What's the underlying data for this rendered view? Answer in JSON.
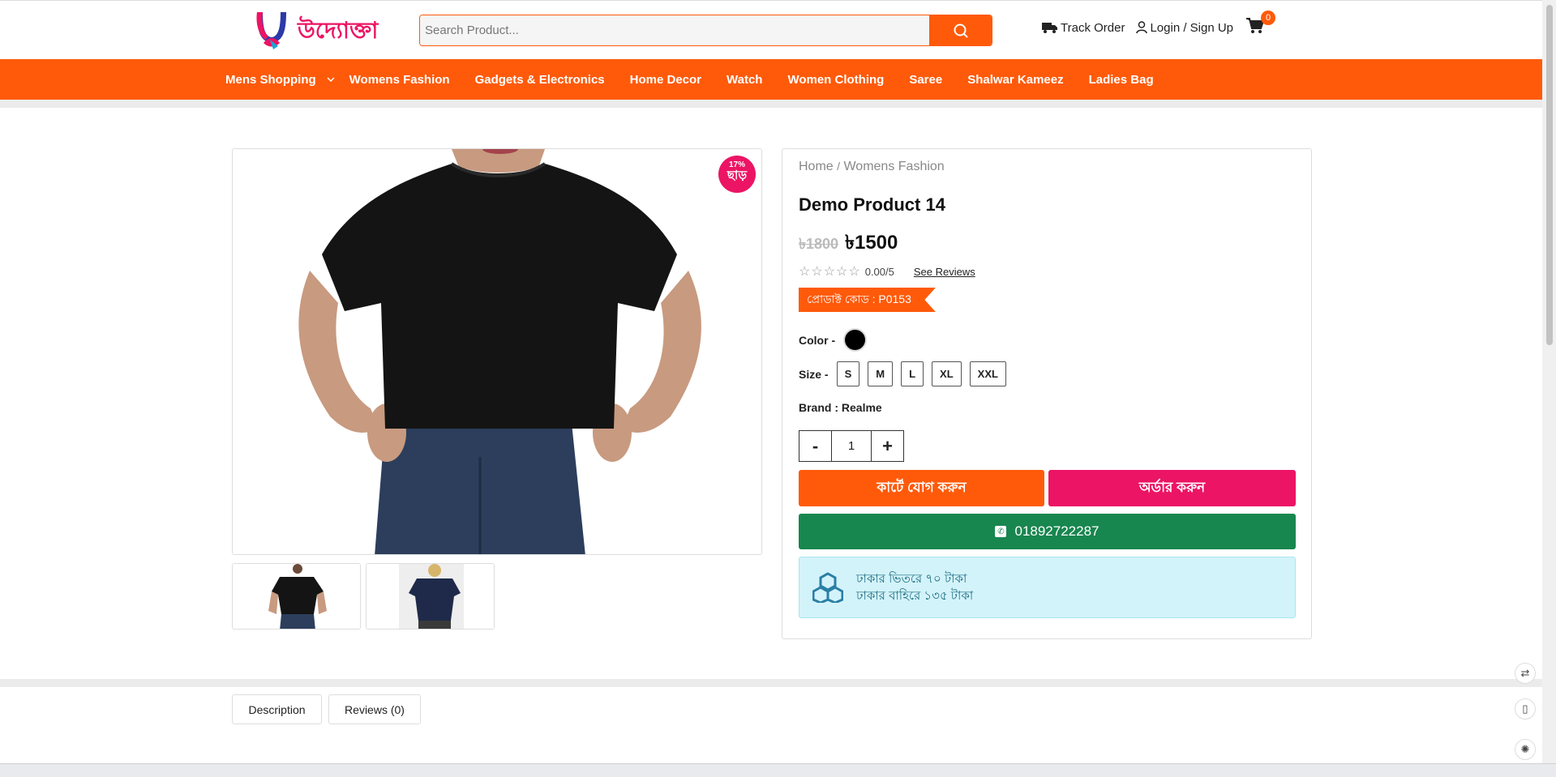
{
  "header": {
    "logo_alt": "উদ্যোক্তা",
    "search_placeholder": "Search Product...",
    "track_order": "Track Order",
    "login": "Login / Sign Up",
    "cart_count": "0"
  },
  "nav": {
    "items": [
      {
        "label": "Mens Shopping",
        "has_dropdown": true
      },
      {
        "label": "Womens Fashion"
      },
      {
        "label": "Gadgets & Electronics"
      },
      {
        "label": "Home Decor"
      },
      {
        "label": "Watch"
      },
      {
        "label": "Women Clothing"
      },
      {
        "label": "Saree"
      },
      {
        "label": "Shalwar Kameez"
      },
      {
        "label": "Ladies Bag"
      }
    ]
  },
  "product": {
    "discount_pct": "17%",
    "discount_label": "ছাড়",
    "breadcrumb_home": "Home",
    "breadcrumb_sep": "/",
    "breadcrumb_category": "Womens Fashion",
    "title": "Demo Product 14",
    "old_price": "৳1800",
    "new_price": "৳1500",
    "rating": "0.00/5",
    "see_reviews": "See Reviews",
    "code": "প্রোডাক্ট কোড : P0153",
    "color_label": "Color -",
    "color_value": "#000000",
    "size_label": "Size -",
    "sizes": [
      "S",
      "M",
      "L",
      "XL",
      "XXL"
    ],
    "brand": "Brand : Realme",
    "quantity": "1",
    "qty_minus": "-",
    "qty_plus": "+",
    "add_to_cart": "কার্টে যোগ করুন",
    "order_now": "অর্ডার করুন",
    "phone": "01892722287",
    "delivery_inside": "ঢাকার ভিতরে ৭০ টাকা",
    "delivery_outside": "ঢাকার বাহিরে ১৩৫ টাকা"
  },
  "tabs": {
    "description": "Description",
    "reviews": "Reviews (0)"
  },
  "colors": {
    "brand_orange": "#ff5a0a",
    "brand_pink": "#ec1464",
    "call_green": "#18864f",
    "delivery_bg": "#d3f3fa"
  }
}
